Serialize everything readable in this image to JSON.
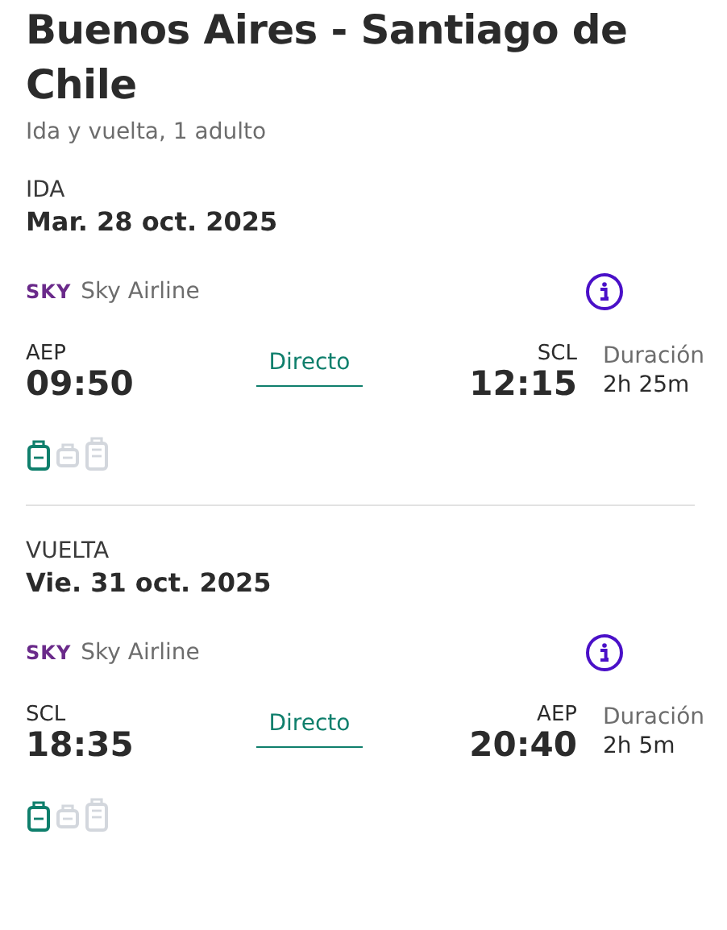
{
  "title": "Buenos Aires - Santiago de Chile",
  "subtitle": "Ida y vuelta, 1 adulto",
  "legs": [
    {
      "label": "IDA",
      "date": "Mar. 28 oct. 2025",
      "airline_logo": "SKY",
      "airline": "Sky Airline",
      "departure": {
        "code": "AEP",
        "time": "09:50"
      },
      "stops": "Directo",
      "arrival": {
        "code": "SCL",
        "time": "12:15"
      },
      "duration_label": "Duración",
      "duration": "2h 25m",
      "bags": [
        {
          "kind": "personal",
          "included": true
        },
        {
          "kind": "carry-on",
          "included": false
        },
        {
          "kind": "checked",
          "included": false
        }
      ]
    },
    {
      "label": "VUELTA",
      "date": "Vie. 31 oct. 2025",
      "airline_logo": "SKY",
      "airline": "Sky Airline",
      "departure": {
        "code": "SCL",
        "time": "18:35"
      },
      "stops": "Directo",
      "arrival": {
        "code": "AEP",
        "time": "20:40"
      },
      "duration_label": "Duración",
      "duration": "2h 5m",
      "bags": [
        {
          "kind": "personal",
          "included": true
        },
        {
          "kind": "carry-on",
          "included": false
        },
        {
          "kind": "checked",
          "included": false
        }
      ]
    }
  ]
}
